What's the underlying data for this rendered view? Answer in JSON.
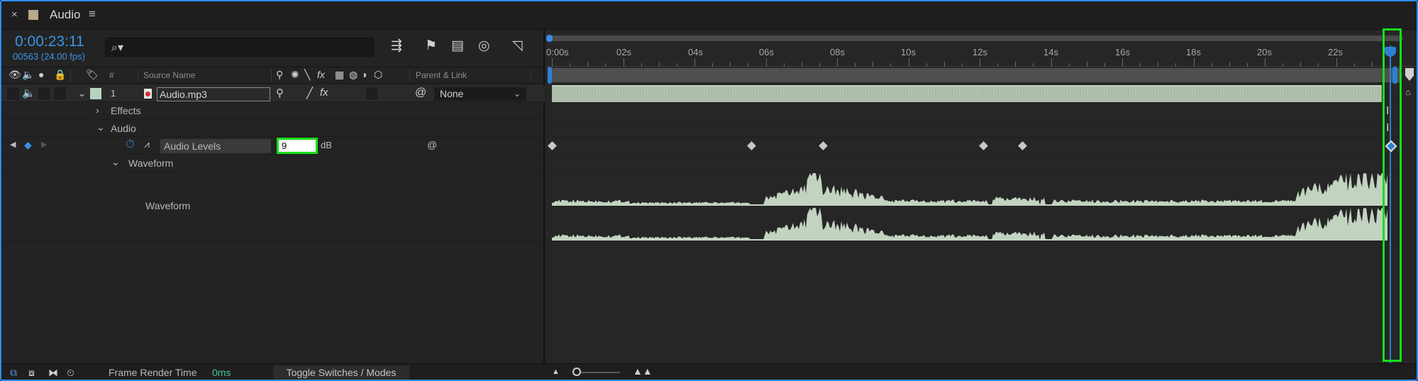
{
  "panel": {
    "close_glyph": "×",
    "title": "Audio",
    "menu_glyph": "≡",
    "swatch_color": "#b9a88a"
  },
  "time": {
    "timecode": "0:00:23:11",
    "frames": "00563 (24.00 fps)"
  },
  "search": {
    "placeholder": ""
  },
  "toolbar_icons": [
    "composition-mini-flowchart-icon",
    "draft-3d-icon",
    "frame-blending-icon",
    "motion-blur-icon",
    "graph-editor-icon"
  ],
  "columns": {
    "number": "#",
    "source_name": "Source Name",
    "parent_link": "Parent & Link",
    "fx": "fx"
  },
  "layer": {
    "number": "1",
    "name": "Audio.mp3",
    "label_color": "#b8d4bd",
    "parent": "None"
  },
  "groups": {
    "effects": "Effects",
    "audio": "Audio",
    "audio_levels": "Audio Levels",
    "audio_levels_value": "9",
    "audio_levels_unit": "dB",
    "waveform_group": "Waveform",
    "waveform_label": "Waveform"
  },
  "ruler": {
    "ticks": [
      "0:00s",
      "02s",
      "04s",
      "06s",
      "08s",
      "10s",
      "12s",
      "14s",
      "16s",
      "18s",
      "20s",
      "22s"
    ]
  },
  "keyframes_seconds": [
    0.0,
    5.6,
    7.6,
    12.1,
    13.2
  ],
  "current_time_seconds": 23.46,
  "footer": {
    "frame_render_label": "Frame Render Time",
    "frame_render_value": "0ms",
    "toggle_button": "Toggle Switches / Modes"
  },
  "colors": {
    "accent": "#2f7fd6",
    "timecode": "#3b94e6",
    "highlight": "#15e015",
    "waveform": "#c2d3c0",
    "render_time": "#46c7a0"
  }
}
